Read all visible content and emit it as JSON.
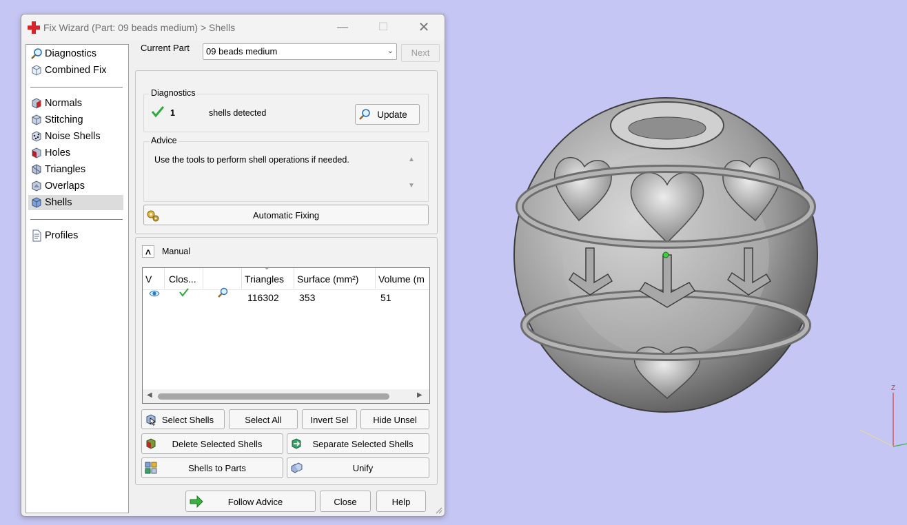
{
  "window": {
    "title": "Fix Wizard (Part: 09 beads medium) > Shells",
    "minimize": "—",
    "maximize": "☐",
    "close": "✕"
  },
  "nav": {
    "items": [
      {
        "label": "Diagnostics",
        "icon": "magnifier-icon"
      },
      {
        "label": "Combined Fix",
        "icon": "cube-outline-icon"
      },
      {
        "label": "Normals",
        "icon": "normals-cube-icon"
      },
      {
        "label": "Stitching",
        "icon": "stitching-cube-icon"
      },
      {
        "label": "Noise Shells",
        "icon": "noise-shells-icon"
      },
      {
        "label": "Holes",
        "icon": "holes-cube-icon"
      },
      {
        "label": "Triangles",
        "icon": "triangles-cube-icon"
      },
      {
        "label": "Overlaps",
        "icon": "overlaps-cube-icon"
      },
      {
        "label": "Shells",
        "icon": "shells-cube-icon"
      },
      {
        "label": "Profiles",
        "icon": "document-icon"
      }
    ],
    "active": "Shells"
  },
  "header": {
    "current_part_label": "Current Part",
    "current_part_value": "09 beads medium",
    "next_label": "Next"
  },
  "diagnostics": {
    "title": "Diagnostics",
    "count": "1",
    "text": "shells detected",
    "update_label": "Update"
  },
  "advice": {
    "title": "Advice",
    "text": "Use the tools to perform shell operations if needed."
  },
  "automatic_fixing_label": "Automatic Fixing",
  "manual": {
    "label": "Manual",
    "collapse_glyph": "˄",
    "table": {
      "columns": [
        "V",
        "Clos...",
        "",
        "Triangles",
        "Surface (mm²)",
        "Volume (m"
      ],
      "rows": [
        {
          "triangles": "116302",
          "surface": "353",
          "volume": "51"
        }
      ]
    },
    "buttons": {
      "select_shells": "Select Shells",
      "select_all": "Select All",
      "invert_sel": "Invert Sel",
      "hide_unsel": "Hide Unsel",
      "delete_selected": "Delete Selected Shells",
      "separate_selected": "Separate Selected Shells",
      "shells_to_parts": "Shells to Parts",
      "unify": "Unify"
    }
  },
  "footer": {
    "follow_advice": "Follow Advice",
    "close": "Close",
    "help": "Help"
  },
  "scene": {
    "axis_label": "Z",
    "model": "3D bead sphere model"
  },
  "colors": {
    "desktop": "#c6c6f4",
    "check": "#2eaa3c",
    "nav_active": "#dcdcdc"
  }
}
